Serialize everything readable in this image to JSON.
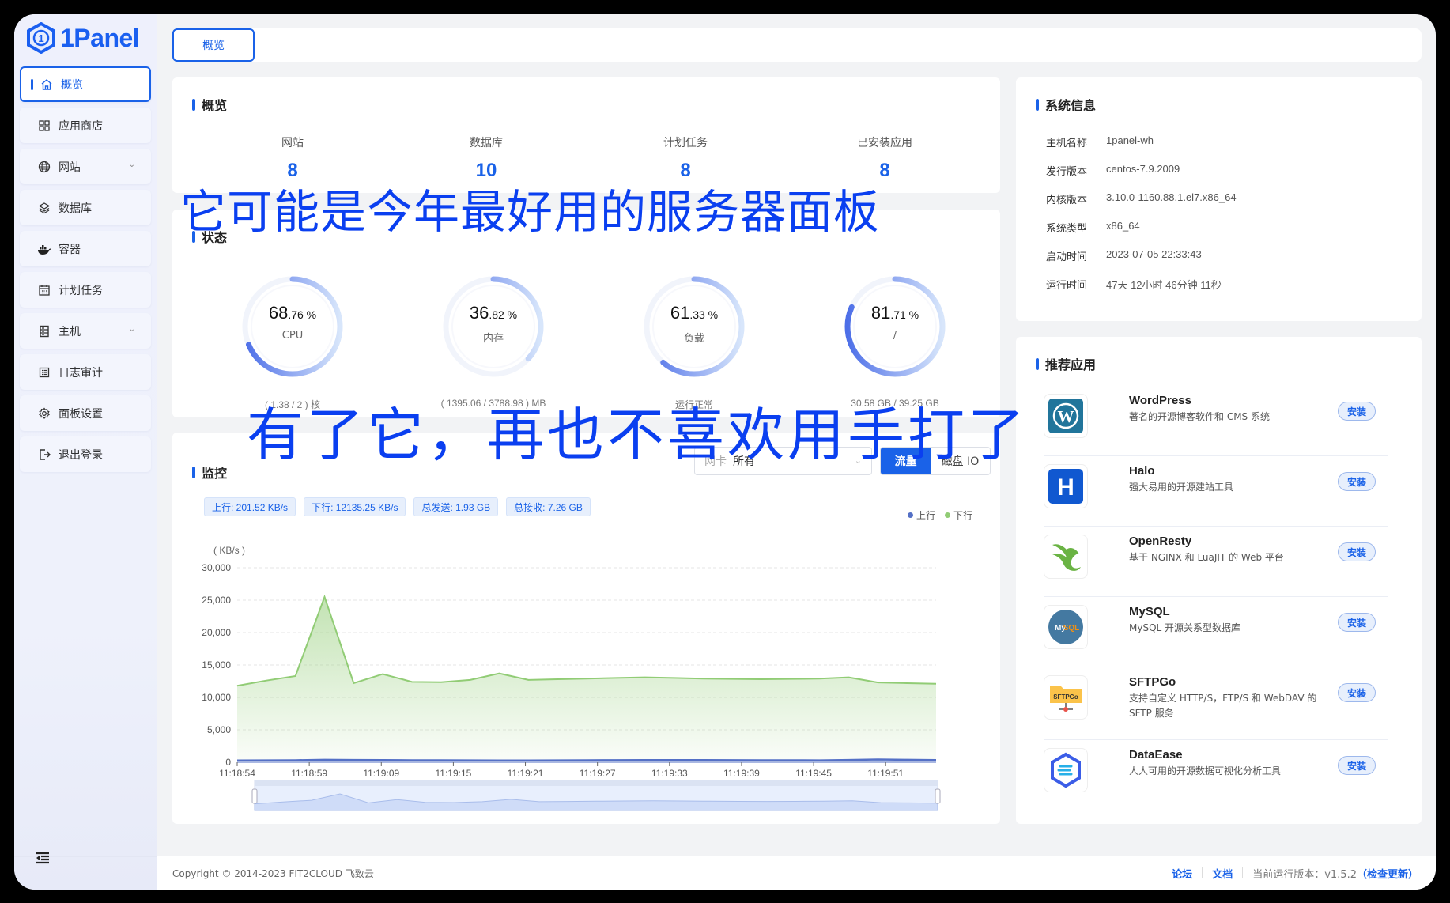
{
  "brand": {
    "name": "1Panel",
    "color": "#1a62e8"
  },
  "sidebar": {
    "items": [
      {
        "label": "概览",
        "icon": "home-icon",
        "active": true
      },
      {
        "label": "应用商店",
        "icon": "grid-icon"
      },
      {
        "label": "网站",
        "icon": "globe-icon",
        "expandable": true
      },
      {
        "label": "数据库",
        "icon": "layers-icon"
      },
      {
        "label": "容器",
        "icon": "docker-icon"
      },
      {
        "label": "计划任务",
        "icon": "calendar-icon"
      },
      {
        "label": "主机",
        "icon": "server-icon",
        "expandable": true
      },
      {
        "label": "日志审计",
        "icon": "list-icon"
      },
      {
        "label": "面板设置",
        "icon": "gear-icon"
      },
      {
        "label": "退出登录",
        "icon": "logout-icon"
      }
    ],
    "collapse_icon": "collapse-menu-icon"
  },
  "tabs": [
    {
      "label": "概览",
      "active": true
    }
  ],
  "overview": {
    "title": "概览",
    "items": [
      {
        "label": "网站",
        "value": "8"
      },
      {
        "label": "数据库",
        "value": "10"
      },
      {
        "label": "计划任务",
        "value": "8"
      },
      {
        "label": "已安装应用",
        "value": "8"
      }
    ]
  },
  "status": {
    "title": "状态",
    "gauges": [
      {
        "int": "68",
        "dec": ".76 %",
        "percent": 68.76,
        "name": "CPU",
        "sub": "( 1.38 / 2 ) 核"
      },
      {
        "int": "36",
        "dec": ".82 %",
        "percent": 36.82,
        "name": "内存",
        "sub": "( 1395.06 / 3788.98 ) MB"
      },
      {
        "int": "61",
        "dec": ".33 %",
        "percent": 61.33,
        "name": "负载",
        "sub": "运行正常"
      },
      {
        "int": "81",
        "dec": ".71 %",
        "percent": 81.71,
        "name": "/",
        "sub": "30.58 GB / 39.25 GB"
      }
    ]
  },
  "monitor": {
    "title": "监控",
    "nic_prefix": "网卡",
    "nic_value": "所有",
    "segments": {
      "traffic": "流量",
      "disk": "磁盘 IO"
    },
    "tags": [
      "上行: 201.52 KB/s",
      "下行: 12135.25 KB/s",
      "总发送: 1.93 GB",
      "总接收: 7.26 GB"
    ]
  },
  "chart_data": {
    "type": "area",
    "ylabel": "( KB/s )",
    "ylim": [
      0,
      30000
    ],
    "yticks": [
      "0",
      "5,000",
      "10,000",
      "15,000",
      "20,000",
      "25,000",
      "30,000"
    ],
    "xticks": [
      "11:18:54",
      "11:18:59",
      "11:19:09",
      "11:19:15",
      "11:19:21",
      "11:19:27",
      "11:19:33",
      "11:19:39",
      "11:19:45",
      "11:19:51"
    ],
    "grid": true,
    "legend_position": "top-right",
    "series": [
      {
        "name": "上行",
        "color": "#5470c6",
        "values": [
          150,
          170,
          190,
          260,
          230,
          210,
          190,
          180,
          170,
          160,
          150,
          170,
          180,
          200,
          210,
          220,
          210,
          200,
          190,
          180,
          170,
          230,
          300,
          260,
          220
        ]
      },
      {
        "name": "下行",
        "color": "#91cc75",
        "values": [
          11800,
          12600,
          13300,
          25500,
          12200,
          13600,
          12400,
          12350,
          12700,
          13700,
          12700,
          12800,
          12900,
          13000,
          13100,
          13000,
          12900,
          12850,
          12800,
          12850,
          12900,
          13100,
          12300,
          12200,
          12100
        ]
      }
    ]
  },
  "system": {
    "title": "系统信息",
    "rows": [
      {
        "k": "主机名称",
        "v": "1panel-wh"
      },
      {
        "k": "发行版本",
        "v": "centos-7.9.2009"
      },
      {
        "k": "内核版本",
        "v": "3.10.0-1160.88.1.el7.x86_64"
      },
      {
        "k": "系统类型",
        "v": "x86_64"
      },
      {
        "k": "启动时间",
        "v": "2023-07-05 22:33:43"
      },
      {
        "k": "运行时间",
        "v": "47天 12小时 46分钟 11秒"
      }
    ]
  },
  "apps": {
    "title": "推荐应用",
    "install_label": "安装",
    "items": [
      {
        "name": "WordPress",
        "desc": "著名的开源博客软件和 CMS 系统",
        "icon": "wordpress-icon"
      },
      {
        "name": "Halo",
        "desc": "强大易用的开源建站工具",
        "icon": "halo-icon"
      },
      {
        "name": "OpenResty",
        "desc": "基于 NGINX 和 LuaJIT 的 Web 平台",
        "icon": "openresty-icon"
      },
      {
        "name": "MySQL",
        "desc": "MySQL 开源关系型数据库",
        "icon": "mysql-icon"
      },
      {
        "name": "SFTPGo",
        "desc": "支持自定义 HTTP/S，FTP/S 和 WebDAV 的 SFTP 服务",
        "icon": "sftpgo-icon"
      },
      {
        "name": "DataEase",
        "desc": "人人可用的开源数据可视化分析工具",
        "icon": "dataease-icon"
      }
    ]
  },
  "footer": {
    "copyright": "Copyright © 2014-2023 FIT2CLOUD 飞致云",
    "forum": "论坛",
    "docs": "文档",
    "version_label": "当前运行版本：v1.5.2",
    "check_update": "（检查更新）"
  },
  "overlay": {
    "line1": "它可能是今年最好用的服务器面板",
    "line2": "有了它，再也不喜欢用手打了"
  }
}
